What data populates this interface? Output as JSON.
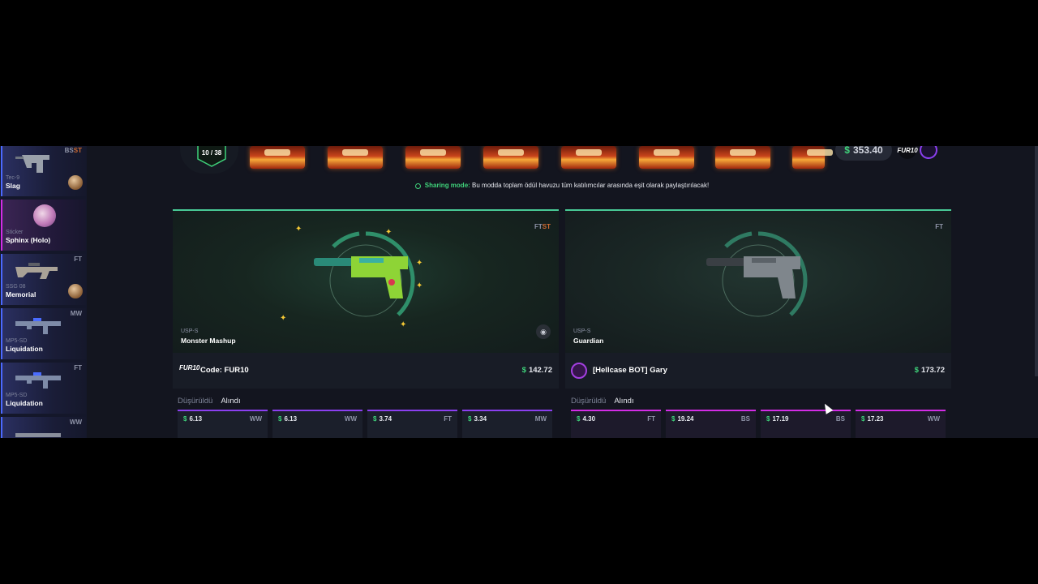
{
  "feed": [
    {
      "type": "Tec-9",
      "name": "Slag",
      "condition": "BS",
      "st": "ST",
      "has_case": true
    },
    {
      "type": "Sticker",
      "name": "Sphinx (Holo)",
      "condition": "",
      "st": "",
      "has_case": false
    },
    {
      "type": "SSG 08",
      "name": "Memorial",
      "condition": "FT",
      "st": "",
      "has_case": true
    },
    {
      "type": "MP5-SD",
      "name": "Liquidation",
      "condition": "MW",
      "st": "",
      "has_case": false
    },
    {
      "type": "MP5-SD",
      "name": "Liquidation",
      "condition": "FT",
      "st": "",
      "has_case": false
    },
    {
      "type": "",
      "name": "",
      "condition": "WW",
      "st": "",
      "has_case": false
    }
  ],
  "header": {
    "progress": "10 / 38",
    "balance_currency": "$",
    "balance": "353.40",
    "user_logo": "FUR10"
  },
  "notice": {
    "mode_label": "Sharing mode:",
    "text": "Bu modda toplam ödül havuzu tüm katılımcılar arasında eşit olarak paylaştırılacak!"
  },
  "players": [
    {
      "item_type": "USP-S",
      "item_name": "Monster Mashup",
      "condition": "FT",
      "st": "ST",
      "player_logo": "FUR10",
      "player_name": "Code: FUR10",
      "currency": "$",
      "total": "142.72",
      "tabs": [
        "Düşürüldü",
        "Alındı"
      ],
      "drops": [
        {
          "price": "6.13",
          "cond": "WW"
        },
        {
          "price": "6.13",
          "cond": "WW"
        },
        {
          "price": "3.74",
          "cond": "FT"
        },
        {
          "price": "3.34",
          "cond": "MW"
        }
      ]
    },
    {
      "item_type": "USP-S",
      "item_name": "Guardian",
      "condition": "FT",
      "st": "",
      "player_logo": "",
      "player_name": "[Hellcase BOT] Gary",
      "currency": "$",
      "total": "173.72",
      "tabs": [
        "Düşürüldü",
        "Alındı"
      ],
      "drops": [
        {
          "price": "4.30",
          "cond": "FT"
        },
        {
          "price": "19.24",
          "cond": "BS"
        },
        {
          "price": "17.19",
          "cond": "BS"
        },
        {
          "price": "17.23",
          "cond": "WW"
        }
      ]
    }
  ],
  "colors": {
    "accent_green": "#3fd27a",
    "panel_border": "#48c995",
    "rarity_purple": "#8b3ff0",
    "rarity_pink": "#d32ce6",
    "rarity_blue": "#4b69ff",
    "stattrak_orange": "#cf6a32"
  },
  "icons": [
    "gun-icon",
    "case-icon",
    "eye-icon",
    "bot-avatar-icon",
    "sharing-mode-icon"
  ]
}
